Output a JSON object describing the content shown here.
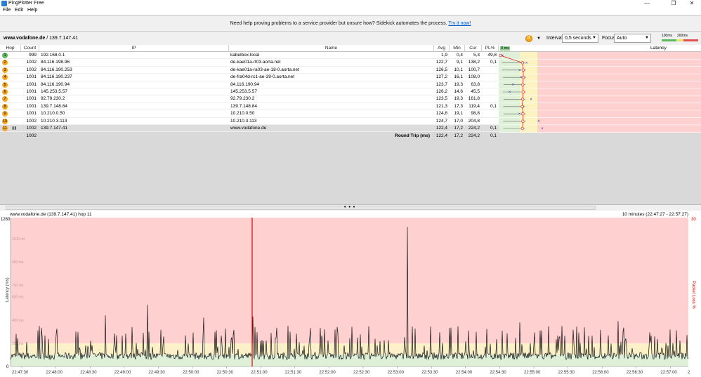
{
  "window": {
    "title": "PingPlotter Free",
    "minimize": "—",
    "maximize": "❐",
    "close": "✕"
  },
  "menu": [
    "File",
    "Edit",
    "Help"
  ],
  "banner": {
    "text": "Need help proving problems to a service provider but unsure how? Sidekick automates the process.",
    "link": "Try it now!"
  },
  "target": {
    "host": "www.vodafone.de",
    "sep": " / ",
    "ip": "139.7.147.41"
  },
  "controls": {
    "interval_label": "Interval",
    "interval_value": "0,5 seconds",
    "focus_label": "Focus",
    "focus_value": "Auto",
    "scale_100": "100ms",
    "scale_200": "200ms"
  },
  "table": {
    "headers": {
      "hop": "Hop",
      "count": "Count",
      "ip": "IP",
      "name": "Name",
      "avg": "Avg",
      "min": "Min",
      "cur": "Cur",
      "pl": "PL%",
      "latency_zero": "0 ms",
      "latency": "Latency"
    },
    "rows": [
      {
        "hop": "1",
        "count": "999",
        "ip": "192.168.0.1",
        "name": "kabelbox.local",
        "avg": "1,9",
        "min": "0,4",
        "cur": "5,3",
        "pl": "49,8",
        "color": "#5cb85c"
      },
      {
        "hop": "2",
        "count": "1002",
        "ip": "84.116.198.96",
        "name": "de-kae01a-rt03.aorta.net",
        "avg": "122,7",
        "min": "9,1",
        "cur": "138,2",
        "pl": "0,1",
        "color": "#f5a623"
      },
      {
        "hop": "3",
        "count": "1002",
        "ip": "84.116.190.253",
        "name": "de-kae01a-ra03-ae-18-0.aorta.net",
        "avg": "126,5",
        "min": "10,1",
        "cur": "100,7",
        "pl": "",
        "color": "#f5a623"
      },
      {
        "hop": "4",
        "count": "1001",
        "ip": "84.116.190.237",
        "name": "de-fra04d-rc1-ae-39-0.aorta.net",
        "avg": "127,2",
        "min": "16,1",
        "cur": "108,0",
        "pl": "",
        "color": "#f5a623"
      },
      {
        "hop": "5",
        "count": "1001",
        "ip": "84.116.190.94",
        "name": "84.116.190.94",
        "avg": "123,7",
        "min": "19,3",
        "cur": "63,8",
        "pl": "",
        "color": "#f5a623"
      },
      {
        "hop": "6",
        "count": "1001",
        "ip": "145.253.5.57",
        "name": "145.253.5.57",
        "avg": "126,2",
        "min": "14,6",
        "cur": "45,5",
        "pl": "",
        "color": "#f5a623"
      },
      {
        "hop": "7",
        "count": "1001",
        "ip": "92.79.230.2",
        "name": "92.79.230.2",
        "avg": "123,5",
        "min": "19,3",
        "cur": "161,8",
        "pl": "",
        "color": "#f5a623"
      },
      {
        "hop": "8",
        "count": "1001",
        "ip": "139.7.148.84",
        "name": "139.7.148.84",
        "avg": "121,3",
        "min": "17,3",
        "cur": "119,4",
        "pl": "0,1",
        "color": "#f5a623"
      },
      {
        "hop": "9",
        "count": "1001",
        "ip": "10.210.0.50",
        "name": "10.210.0.50",
        "avg": "124,8",
        "min": "19,1",
        "cur": "98,8",
        "pl": "",
        "color": "#f5a623"
      },
      {
        "hop": "10",
        "count": "1002",
        "ip": "10.210.3.113",
        "name": "10.210.3.113",
        "avg": "124,7",
        "min": "17,0",
        "cur": "204,8",
        "pl": "",
        "color": "#f5a623"
      },
      {
        "hop": "11",
        "count": "1002",
        "ip": "139.7.147.41",
        "name": "www.vodafone.de",
        "avg": "122,4",
        "min": "17,2",
        "cur": "224,2",
        "pl": "0,1",
        "color": "#f5a623"
      }
    ],
    "roundtrip": {
      "count": "1002",
      "label": "Round Trip (ms)",
      "avg": "122,4",
      "min": "17,2",
      "cur": "224,2",
      "pl": "0,1"
    }
  },
  "timeline": {
    "header_left": "www.vodafone.de (139.7.147.41) hop 11",
    "header_right": "10 minutes (22:47:27 - 22:57:27)",
    "y_top": "1280",
    "y_zero": "0",
    "y_axis_label": "Latency (ms)",
    "right_axis_top": "30",
    "right_axis_label": "Packet Loss %",
    "y_ticks": [
      "1100 ms",
      "900 ms",
      "700 ms",
      "600 ms",
      "400 ms",
      "200 ms"
    ],
    "x_ticks": [
      "22:47:30",
      "22:48:00",
      "22:48:30",
      "22:49:00",
      "22:49:30",
      "22:50:00",
      "22:50:30",
      "22:51:00",
      "22:51:30",
      "22:52:00",
      "22:52:30",
      "22:53:00",
      "22:53:30",
      "22:54:00",
      "22:54:30",
      "22:55:00",
      "22:55:30",
      "22:56:00",
      "22:56:30",
      "22:57:00"
    ],
    "x_tail": "2"
  }
}
